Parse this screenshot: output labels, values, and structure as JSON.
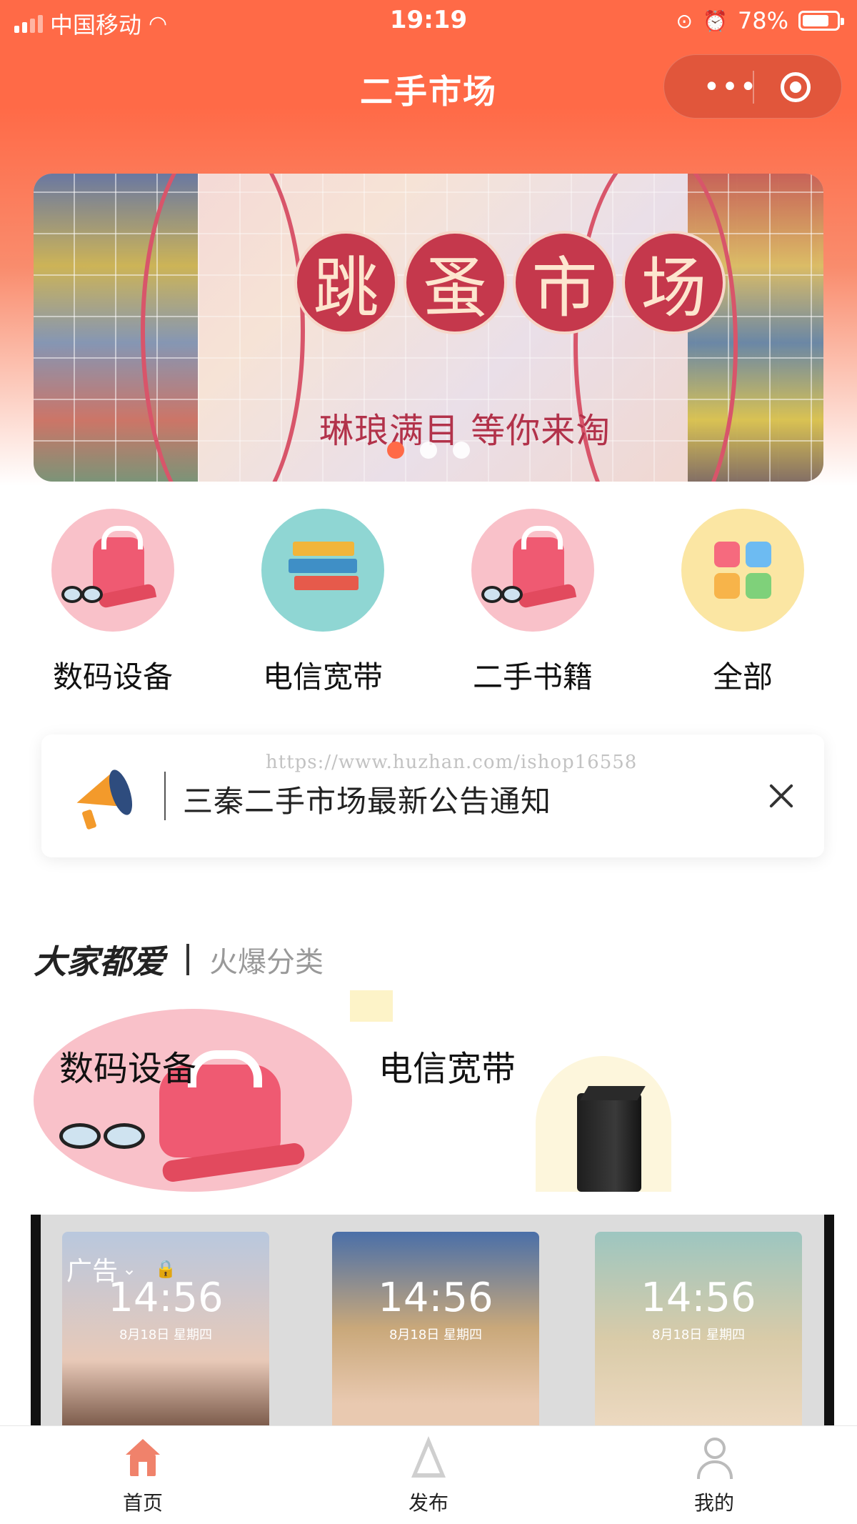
{
  "status_bar": {
    "carrier": "中国移动",
    "time": "19:19",
    "battery": "78%",
    "battery_level": 0.78
  },
  "nav": {
    "title": "二手市场",
    "menu_icon": "more-dots-icon",
    "close_icon": "target-icon"
  },
  "banner": {
    "title_chars": [
      "跳",
      "蚤",
      "市",
      "场"
    ],
    "slogan": "琳琅满目 等你来淘",
    "indicator_count": 3,
    "active_index": 0
  },
  "categories": [
    {
      "label": "数码设备",
      "icon": "bag-heels-icon"
    },
    {
      "label": "电信宽带",
      "icon": "books-icon"
    },
    {
      "label": "二手书籍",
      "icon": "bag-heels-icon"
    },
    {
      "label": "全部",
      "icon": "grid-tiles-icon"
    }
  ],
  "notice": {
    "text": "三秦二手市场最新公告通知",
    "icon": "megaphone-icon",
    "close_icon": "close-icon"
  },
  "watermark": "https://www.huzhan.com/ishop16558",
  "section": {
    "title": "大家都爱",
    "subtitle": "火爆分类"
  },
  "popular": [
    {
      "label": "数码设备"
    },
    {
      "label": "电信宽带"
    }
  ],
  "ad": {
    "tag": "广告",
    "phones": [
      {
        "time": "14:56",
        "date": "8月18日 星期四"
      },
      {
        "time": "14:56",
        "date": "8月18日 星期四"
      },
      {
        "time": "14:56",
        "date": "8月18日 星期四"
      }
    ]
  },
  "tabbar": {
    "items": [
      {
        "label": "首页",
        "icon": "home-icon",
        "active": true
      },
      {
        "label": "发布",
        "icon": "send-icon",
        "active": false
      },
      {
        "label": "我的",
        "icon": "user-icon",
        "active": false
      }
    ]
  },
  "colors": {
    "primary": "#ff6a47",
    "category_pink": "#f9c1c9",
    "category_teal": "#8fd6d3",
    "category_yellow": "#fbe6a3"
  }
}
